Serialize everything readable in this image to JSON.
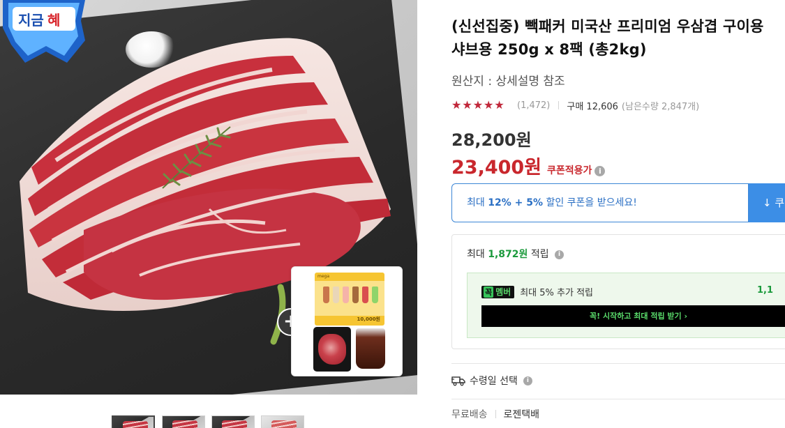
{
  "badge": {
    "text": "지금혜택"
  },
  "gallery": {
    "thumbnails": [
      "thumbnail-1",
      "thumbnail-2",
      "thumbnail-3",
      "thumbnail-4"
    ],
    "gift": {
      "coupon_amount": "10,000원"
    }
  },
  "product": {
    "title": "(신선집중) 빽패커 미국산 프리미엄 우삼겹 구이용 샤브용 250g x 8팩 (총2kg)",
    "origin": "원산지 : 상세설명 참조",
    "rating": 4.5,
    "rating_max": 5,
    "review_count": "(1,472)",
    "purchase_label": "구매 12,606",
    "remaining_label": "(남은수량 2,847개)",
    "original_price": "28,200원",
    "sale_price": "23,400원",
    "sale_price_tag": "쿠폰적용가"
  },
  "coupon": {
    "prefix": "최대 ",
    "pct1": "12%",
    "plus": " + ",
    "pct2": "5%",
    "suffix": " 할인 쿠폰을 받으세요!",
    "button_label": "↓ 쿠"
  },
  "points": {
    "prefix": "최대 ",
    "amount": "1,872원",
    "suffix": " 적립",
    "member": {
      "badge_k": "꼭",
      "badge_label": "멤버",
      "text": "최대 5% 추가 적립",
      "value": "1,1",
      "cta": "꼭! 시작하고 최대 적립 받기 ›"
    }
  },
  "delivery": {
    "receive_date_label": "수령일 선택",
    "shipping_fee": "무료배송",
    "carrier": "로젠택배"
  },
  "colors": {
    "sale_red": "#c9272d",
    "coupon_blue": "#2a6fc4",
    "points_green": "#1b9a3c",
    "star_red": "#c2273a"
  }
}
